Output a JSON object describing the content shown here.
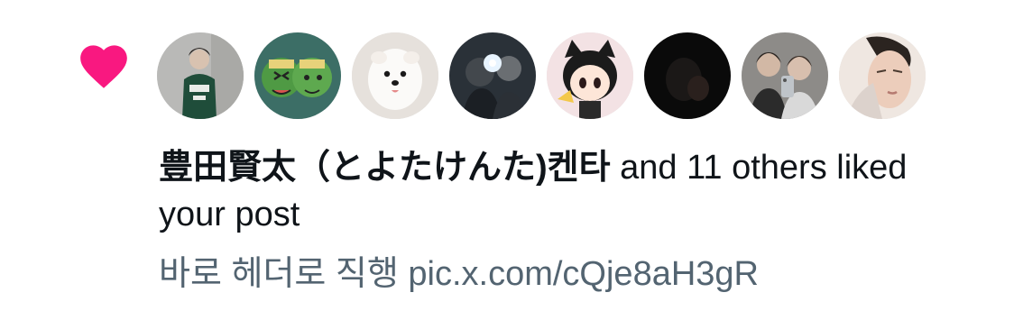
{
  "notification": {
    "actor_name": "豊田賢太（とよたけんた)켄타",
    "action_text": " and 11 others liked your post",
    "post_preview": "바로 헤더로 직행 pic.x.com/cQje8aH3gR"
  },
  "colors": {
    "heart": "#f91880",
    "text": "#0f1419",
    "muted": "#536471"
  },
  "icons": {
    "heart": "heart-icon"
  },
  "avatars": [
    {
      "name": "avatar-user-1"
    },
    {
      "name": "avatar-user-2"
    },
    {
      "name": "avatar-user-3"
    },
    {
      "name": "avatar-user-4"
    },
    {
      "name": "avatar-user-5"
    },
    {
      "name": "avatar-user-6"
    },
    {
      "name": "avatar-user-7"
    },
    {
      "name": "avatar-user-8"
    }
  ]
}
